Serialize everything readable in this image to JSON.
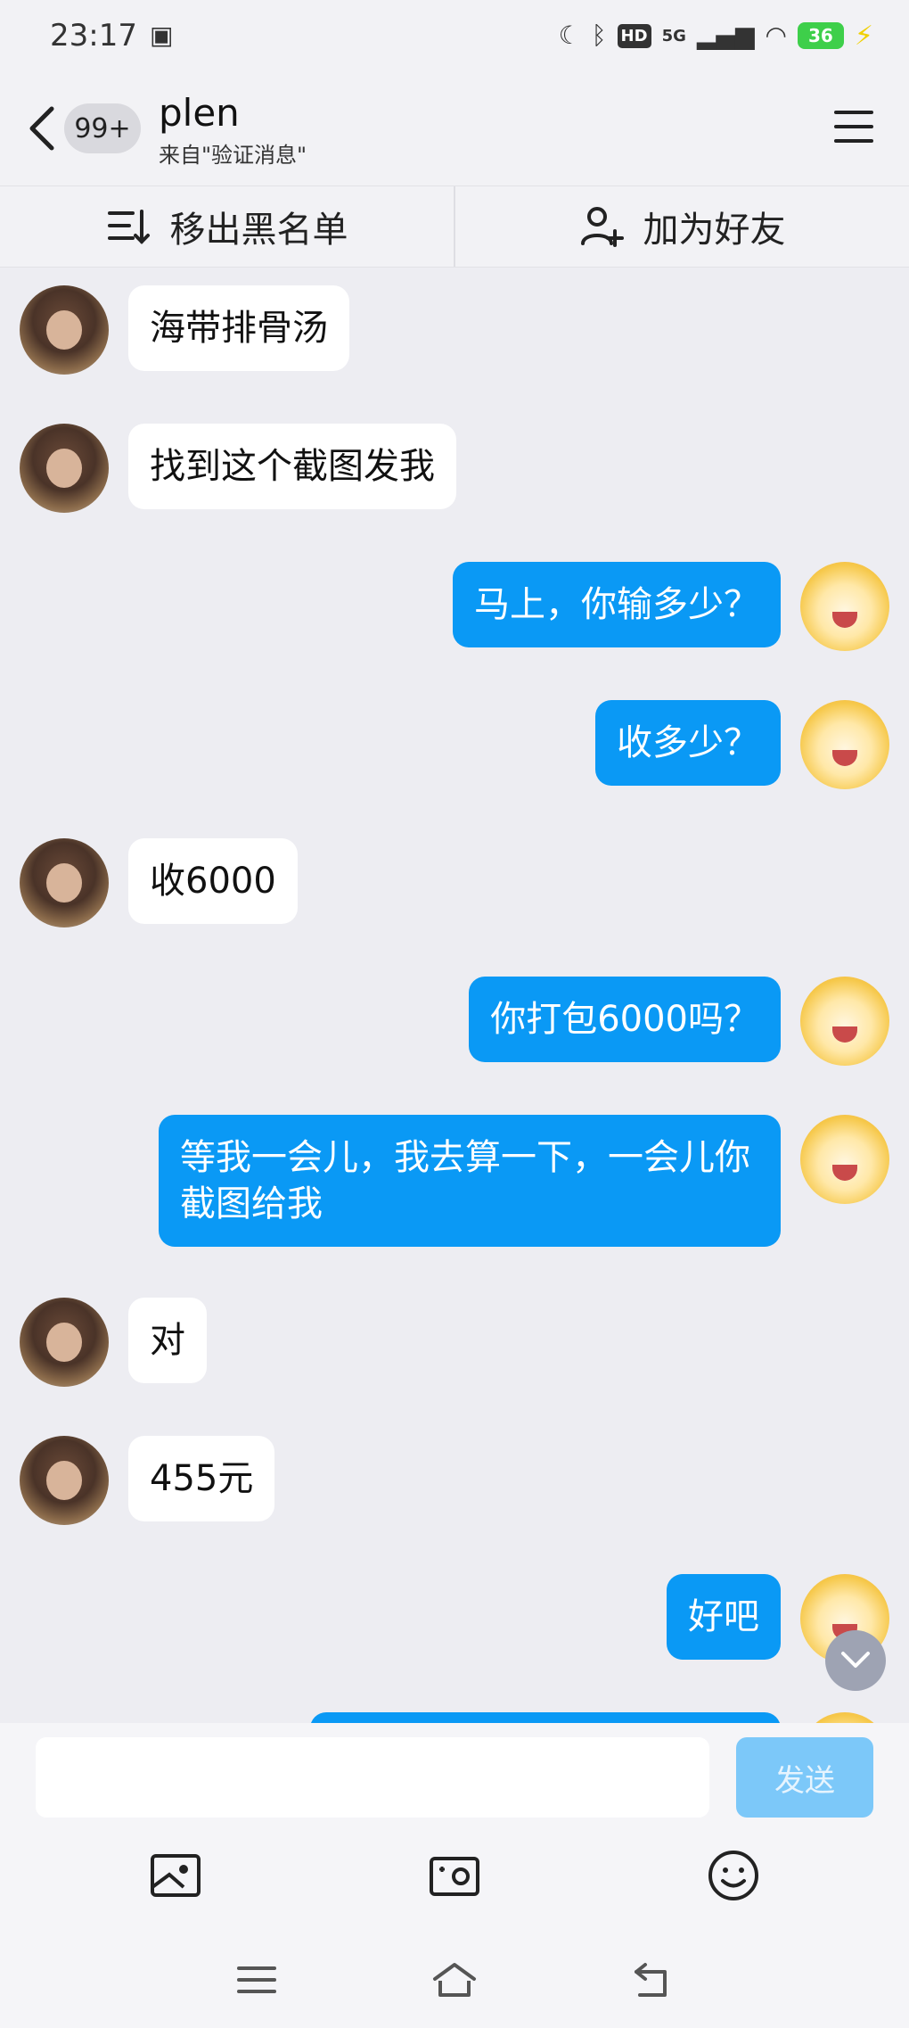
{
  "status_bar": {
    "time": "23:17",
    "network": "5G",
    "hd": "HD",
    "battery": "36"
  },
  "header": {
    "unread_count": "99+",
    "title": "plen",
    "subtitle": "来自\"验证消息\""
  },
  "actions": {
    "remove_blacklist": "移出黑名单",
    "add_friend": "加为好友"
  },
  "messages": [
    {
      "side": "in",
      "text": "海带排骨汤"
    },
    {
      "side": "in",
      "text": "找到这个截图发我"
    },
    {
      "side": "out",
      "text": "马上，你输多少？"
    },
    {
      "side": "out",
      "text": "收多少？"
    },
    {
      "side": "in",
      "text": "收6000"
    },
    {
      "side": "out",
      "text": "你打包6000吗？"
    },
    {
      "side": "out",
      "text": "等我一会儿，我去算一下，一会儿你截图给我"
    },
    {
      "side": "in",
      "text": "对"
    },
    {
      "side": "in",
      "text": "455元"
    },
    {
      "side": "out",
      "text": "好吧"
    },
    {
      "side": "out",
      "text": ""
    }
  ],
  "input": {
    "value": "",
    "send_label": "发送"
  },
  "colors": {
    "outgoing_bubble": "#0a99f5",
    "incoming_bubble": "#ffffff",
    "send_disabled": "#7cc8f9"
  }
}
